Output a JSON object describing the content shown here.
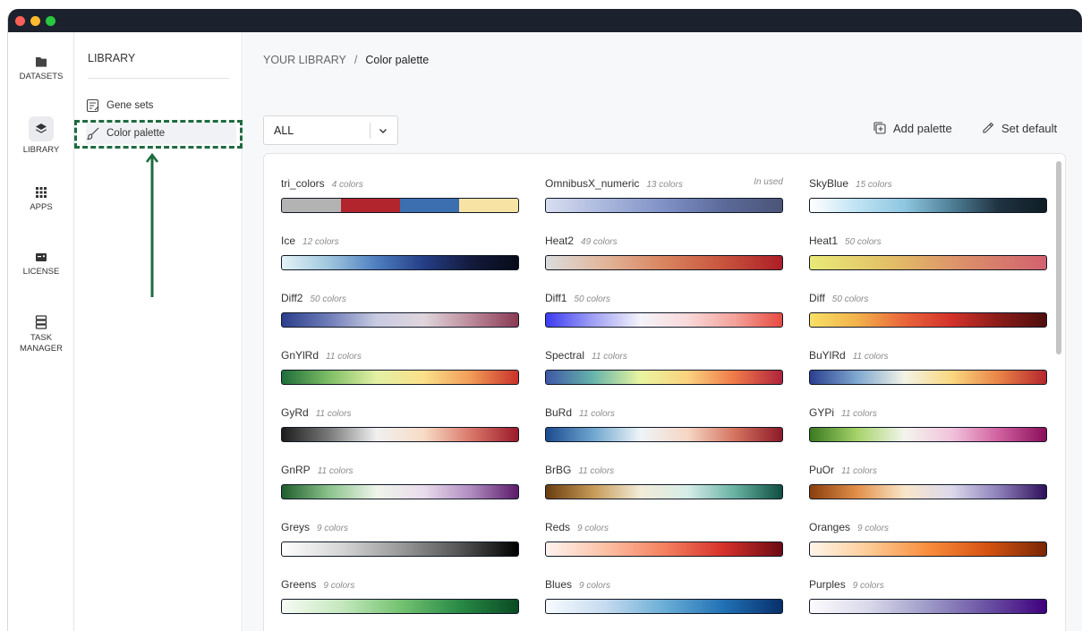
{
  "rail": {
    "datasets": "DATASETS",
    "library": "LIBRARY",
    "apps": "APPS",
    "license": "LICENSE",
    "task_manager_1": "TASK",
    "task_manager_2": "MANAGER"
  },
  "library_panel": {
    "title": "LIBRARY",
    "items": [
      "Gene sets",
      "Color palette"
    ],
    "active_item": "Color palette",
    "highlight_color": "#1e6b3f"
  },
  "breadcrumb": {
    "root": "YOUR LIBRARY",
    "separator": "/",
    "current": "Color palette"
  },
  "filter": {
    "value": "ALL"
  },
  "actions": {
    "add_palette": "Add palette",
    "set_default": "Set default"
  },
  "palettes": [
    {
      "name": "tri_colors",
      "count": "4 colors",
      "used": "",
      "colors": [
        "#b3b3b3",
        "#b3252c",
        "#3b6fb0",
        "#f7e3a3"
      ],
      "discrete": true
    },
    {
      "name": "OmnibusX_numeric",
      "count": "13 colors",
      "used": "In used",
      "colors": [
        "#d8def0",
        "#a9b7dc",
        "#7f91c6",
        "#5b6a9a",
        "#4c5577"
      ]
    },
    {
      "name": "SkyBlue",
      "count": "15 colors",
      "used": "",
      "colors": [
        "#ffffff",
        "#bfe3f3",
        "#8ec7e0",
        "#4f7f96",
        "#1f3240",
        "#0f1c24"
      ]
    },
    {
      "name": "Ice",
      "count": "12 colors",
      "used": "",
      "colors": [
        "#e4f3f7",
        "#9fc6de",
        "#4e7ec0",
        "#253e86",
        "#131a3c",
        "#070b18"
      ]
    },
    {
      "name": "Heat2",
      "count": "49 colors",
      "used": "",
      "colors": [
        "#dcdcdc",
        "#e2b59a",
        "#d9845f",
        "#c8543d",
        "#ad1e26"
      ]
    },
    {
      "name": "Heat1",
      "count": "50 colors",
      "used": "",
      "colors": [
        "#e9ea78",
        "#e3c067",
        "#dc8d6a",
        "#d2616f"
      ]
    },
    {
      "name": "Diff2",
      "count": "50 colors",
      "used": "",
      "colors": [
        "#2b3f8c",
        "#6f7db8",
        "#c8cbe2",
        "#e0d6dc",
        "#bb8a9a",
        "#8a3a53"
      ]
    },
    {
      "name": "Diff1",
      "count": "50 colors",
      "used": "",
      "colors": [
        "#3c3cf2",
        "#a0a0f4",
        "#f4f4fb",
        "#f9d9d9",
        "#f3a29a",
        "#e74a40"
      ]
    },
    {
      "name": "Diff",
      "count": "50 colors",
      "used": "",
      "colors": [
        "#f7e065",
        "#f2b24b",
        "#e9653b",
        "#d3322a",
        "#8a1c19",
        "#4e0e0c"
      ]
    },
    {
      "name": "GnYlRd",
      "count": "11 colors",
      "used": "",
      "colors": [
        "#1f6e3a",
        "#7fbe66",
        "#e3f0a4",
        "#fbe08a",
        "#f19b56",
        "#c9322b"
      ]
    },
    {
      "name": "Spectral",
      "count": "11 colors",
      "used": "",
      "colors": [
        "#3e58a6",
        "#67b4aa",
        "#e9f5a0",
        "#fbd27e",
        "#ef7848",
        "#b0243d"
      ]
    },
    {
      "name": "BuYlRd",
      "count": "11 colors",
      "used": "",
      "colors": [
        "#2b3f8f",
        "#7fa8d1",
        "#f3f3e5",
        "#fad87f",
        "#e98347",
        "#b5262c"
      ]
    },
    {
      "name": "GyRd",
      "count": "11 colors",
      "used": "",
      "colors": [
        "#1c1c1c",
        "#7a7a7a",
        "#f0f0f0",
        "#f8dcc6",
        "#d9776a",
        "#9c1a2a"
      ]
    },
    {
      "name": "BuRd",
      "count": "11 colors",
      "used": "",
      "colors": [
        "#1b4b8f",
        "#6fa6cf",
        "#eef4f8",
        "#f6d6c4",
        "#d4735f",
        "#8c1a28"
      ]
    },
    {
      "name": "GYPi",
      "count": "11 colors",
      "used": "",
      "colors": [
        "#3a7a1f",
        "#a6d36a",
        "#f3f4ec",
        "#f2c3dc",
        "#d0609f",
        "#8a0f5a"
      ]
    },
    {
      "name": "GnRP",
      "count": "11 colors",
      "used": "",
      "colors": [
        "#1f5e2d",
        "#8cc38c",
        "#eef5ea",
        "#eadcec",
        "#b08cc0",
        "#5c1a6a"
      ]
    },
    {
      "name": "BrBG",
      "count": "11 colors",
      "used": "",
      "colors": [
        "#6a3d0f",
        "#c69a57",
        "#f3ecd8",
        "#d6ede8",
        "#67b1a3",
        "#0f4f3f"
      ]
    },
    {
      "name": "PuOr",
      "count": "11 colors",
      "used": "",
      "colors": [
        "#8a3f0c",
        "#e2904a",
        "#f9e6c9",
        "#dcd9ec",
        "#8c7fb8",
        "#2f0f5a"
      ]
    },
    {
      "name": "Greys",
      "count": "9 colors",
      "used": "",
      "colors": [
        "#ffffff",
        "#d6d6d6",
        "#9a9a9a",
        "#555555",
        "#000000"
      ]
    },
    {
      "name": "Reds",
      "count": "9 colors",
      "used": "",
      "colors": [
        "#fff3ee",
        "#fcc1a5",
        "#f5815f",
        "#d6322b",
        "#6c0a14"
      ]
    },
    {
      "name": "Oranges",
      "count": "9 colors",
      "used": "",
      "colors": [
        "#fff5ea",
        "#fdcb95",
        "#f98d3c",
        "#d55311",
        "#7a2706"
      ]
    },
    {
      "name": "Greens",
      "count": "9 colors",
      "used": "",
      "colors": [
        "#f6fbf3",
        "#c6e8bf",
        "#75c372",
        "#298a47",
        "#0a4b22"
      ]
    },
    {
      "name": "Blues",
      "count": "9 colors",
      "used": "",
      "colors": [
        "#f7fbff",
        "#c6dbef",
        "#6baed6",
        "#2171b5",
        "#08306b"
      ]
    },
    {
      "name": "Purples",
      "count": "9 colors",
      "used": "",
      "colors": [
        "#fcfbfd",
        "#d9d8ea",
        "#9e9ac8",
        "#6a51a3",
        "#3f007d"
      ]
    }
  ]
}
